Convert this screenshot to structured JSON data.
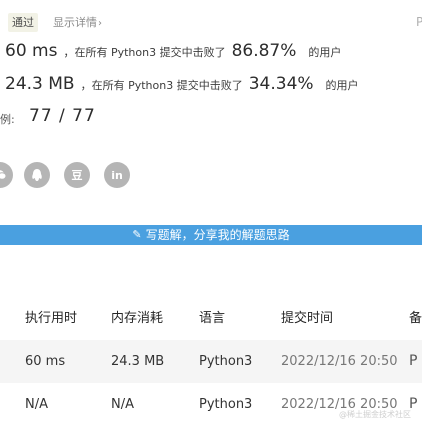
{
  "status": {
    "badge": "通过",
    "details_link": "显示详情",
    "details_chevron": "›",
    "edge_letter": "P"
  },
  "runtime": {
    "value": "60 ms",
    "text": "，在所有 Python3 提交中击败了",
    "percent": "86.87%",
    "suffix": "的用户"
  },
  "memory": {
    "value": "24.3 MB",
    "text": "，在所有 Python3 提交中击败了",
    "percent": "34.34%",
    "suffix": "的用户"
  },
  "cases": {
    "label": "例:",
    "value": "77 / 77"
  },
  "share": {
    "icons": [
      "wechat-icon",
      "qq-icon",
      "douban-icon",
      "linkedin-icon"
    ],
    "glyphs": [
      "",
      "",
      "豆",
      "in"
    ]
  },
  "banner": {
    "label": "写题解，分享我的解题思路",
    "color": "#4aa0e0"
  },
  "table": {
    "headers": [
      "执行用时",
      "内存消耗",
      "语言",
      "提交时间",
      "备"
    ],
    "rows": [
      [
        "60 ms",
        "24.3 MB",
        "Python3",
        "2022/12/16 20:50",
        "P"
      ],
      [
        "N/A",
        "N/A",
        "Python3",
        "2022/12/16 20:50",
        "P"
      ]
    ]
  },
  "watermark": "@稀土掘金技术社区"
}
